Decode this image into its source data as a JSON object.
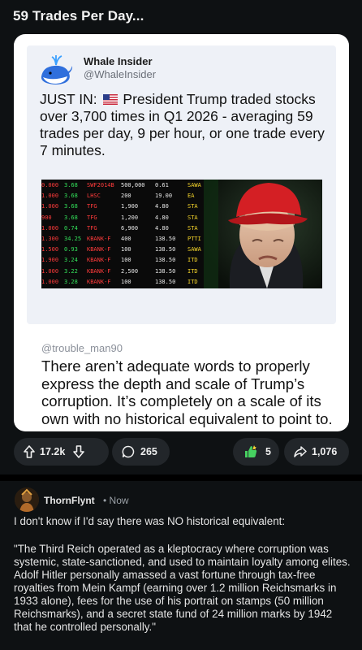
{
  "post": {
    "title": "59 Trades Per Day..."
  },
  "tweet": {
    "name": "Whale Insider",
    "handle": "@WhaleInsider",
    "body_prefix": "JUST IN: ",
    "body_rest": " President Trump traded stocks over 3,700 times in Q1 2026 - averaging 59 trades per day, 9 per hour, or one trade every 7 minutes.",
    "flag_icon": "us-flag-icon",
    "avatar_icon": "whale-logo-icon"
  },
  "ticker": {
    "rows": [
      {
        "a": "0.000",
        "b": "3.68",
        "c": "SWF2014B",
        "d": "500,000",
        "e": "0.61",
        "f": "SAWA"
      },
      {
        "a": "1.000",
        "b": "3.68",
        "c": "LHSC",
        "d": "200",
        "e": "19.00",
        "f": "EA"
      },
      {
        "a": "1.000",
        "b": "3.68",
        "c": "TFG",
        "d": "1,900",
        "e": "4.80",
        "f": "STA"
      },
      {
        "a": "900",
        "b": "3.68",
        "c": "TFG",
        "d": "1,200",
        "e": "4.80",
        "f": "STA"
      },
      {
        "a": "1.000",
        "b": "0.74",
        "c": "TFG",
        "d": "6,900",
        "e": "4.80",
        "f": "STA"
      },
      {
        "a": "1.300",
        "b": "34.25",
        "c": "KBANK-F",
        "d": "400",
        "e": "138.50",
        "f": "PTTI"
      },
      {
        "a": "1.500",
        "b": "0.93",
        "c": "KBANK-F",
        "d": "100",
        "e": "138.50",
        "f": "SAWA"
      },
      {
        "a": "1.900",
        "b": "3.24",
        "c": "KBANK-F",
        "d": "100",
        "e": "138.50",
        "f": "ITD"
      },
      {
        "a": "1.000",
        "b": "3.22",
        "c": "KBANK-F",
        "d": "2,500",
        "e": "138.50",
        "f": "ITD"
      },
      {
        "a": "1.000",
        "b": "3.28",
        "c": "KBANK-F",
        "d": "100",
        "e": "138.50",
        "f": "ITD"
      }
    ]
  },
  "quote": {
    "handle": "@trouble_man90",
    "body": "There aren’t adequate words to properly express the depth and scale of Trump’s corruption. It’s completely on a scale of its own with no historical equivalent to point to."
  },
  "actions": {
    "upvotes": "17.2k",
    "comments": "265",
    "awards": "5",
    "shares": "1,076"
  },
  "comment": {
    "username": "ThornFlynt",
    "time": "• Now",
    "paragraph1": "I don't know if I'd say there was NO historical equivalent:",
    "paragraph2": "\"The Third Reich operated as a kleptocracy where corruption was systemic, state-sanctioned, and used to maintain loyalty among elites. Adolf Hitler personally amassed a vast fortune through tax-free royalties from Mein Kampf (earning over 1.2 million Reichsmarks in 1933 alone), fees for the use of his portrait on stamps (50 million Reichsmarks), and a secret state fund of 24 million marks by 1942 that he controlled personally.\""
  },
  "colors": {
    "background": "#0e1113",
    "pill": "#22262a",
    "card": "#ffffff",
    "tweet_bg": "#eef1f7",
    "award_green": "#46d160"
  }
}
